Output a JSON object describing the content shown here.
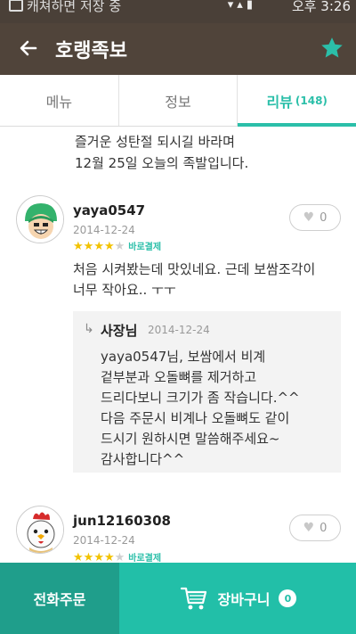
{
  "status_bar": {
    "toast": "캐쳐하면 저장 중",
    "clock": "오후 3:26"
  },
  "header": {
    "title": "호랭족보",
    "back_icon": "arrow-left-icon",
    "favorite_icon": "star-icon",
    "accent": "#2bbfa9"
  },
  "tabs": [
    {
      "label": "메뉴",
      "active": false
    },
    {
      "label": "정보",
      "active": false
    },
    {
      "label": "리뷰",
      "count": "(148)",
      "active": true
    }
  ],
  "intro_text": {
    "line1": "즐거운 성탄절 되시길 바라며",
    "line2": "12월 25일 오늘의 족발입니다."
  },
  "reviews": [
    {
      "author": "yaya0547",
      "date": "2014-12-24",
      "rating": 4,
      "max_rating": 5,
      "payment_tag": "바로결제",
      "likes": "0",
      "text_line1": "처음 시켜봤는데 맛있네요. 근데 보쌈조각이",
      "text_line2": "너무 작아요.. ㅜㅜ",
      "reply": {
        "author": "사장님",
        "date": "2014-12-24",
        "text": "yaya0547님, 보쌈에서 비계\n겉부분과 오돌뼈를 제거하고\n드리다보니 크기가 좀 작습니다.^^\n다음 주문시 비계나 오돌뼈도 같이\n드시기 원하시면 말씀해주세요~\n감사합니다^^"
      }
    },
    {
      "author": "jun12160308",
      "date": "2014-12-24",
      "rating": 4,
      "max_rating": 5,
      "payment_tag": "바로결제",
      "likes": "0"
    }
  ],
  "bottom_bar": {
    "call_label": "전화주문",
    "cart_label": "장바구니",
    "cart_count": "0",
    "cart_icon": "cart-icon"
  }
}
